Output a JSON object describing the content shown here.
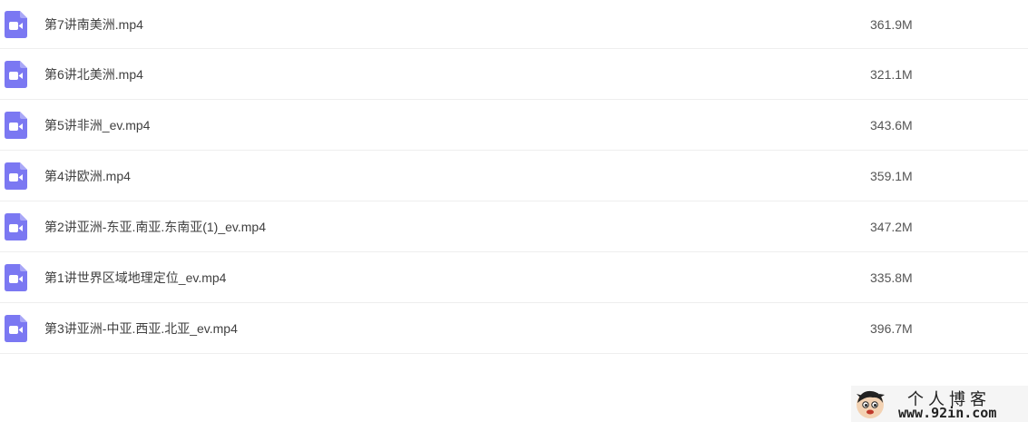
{
  "file_list": {
    "icon": "video-file-icon",
    "icon_color": "#7b78f2",
    "rows": [
      {
        "name": "第7讲南美洲.mp4",
        "size": "361.9M"
      },
      {
        "name": "第6讲北美洲.mp4",
        "size": "321.1M"
      },
      {
        "name": "第5讲非洲_ev.mp4",
        "size": "343.6M"
      },
      {
        "name": "第4讲欧洲.mp4",
        "size": "359.1M"
      },
      {
        "name": "第2讲亚洲-东亚.南亚.东南亚(1)_ev.mp4",
        "size": "347.2M"
      },
      {
        "name": "第1讲世界区域地理定位_ev.mp4",
        "size": "335.8M"
      },
      {
        "name": "第3讲亚洲-中亚.西亚.北亚_ev.mp4",
        "size": "396.7M"
      }
    ]
  },
  "watermark": {
    "title": "个人博客",
    "url": "www.92in.com",
    "logo_icon": "cartoon-avatar-icon"
  }
}
